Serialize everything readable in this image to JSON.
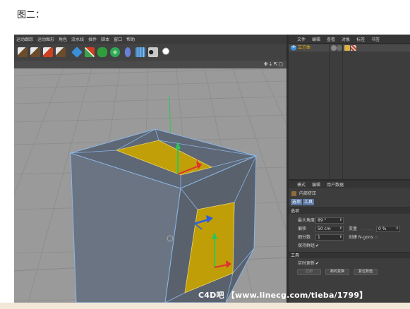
{
  "caption": "图二：",
  "menubar": {
    "items": [
      "运动跟踪",
      "运动图形",
      "角色",
      "流水线",
      "插件",
      "脚本",
      "窗口",
      "帮助"
    ]
  },
  "toolbar": {
    "icons": [
      "render-region-icon",
      "render-view-icon",
      "render-picture-viewer-icon",
      "render-settings-icon",
      "cube-icon",
      "pen-icon",
      "subdivision-icon",
      "cloner-icon",
      "deformer-icon",
      "floor-icon",
      "camera-icon",
      "light-icon"
    ],
    "colors": [
      "#6a4c2a",
      "#6a4c2a",
      "#6a4c2a",
      "#6a4c2a",
      "#3a8fd6",
      "#3aa34a",
      "#2f9e3a",
      "#2fa85a",
      "#6a7fd8",
      "#4d8fc9",
      "#c8c8c8",
      "#e8e8e8"
    ]
  },
  "viewport": {
    "nav_icons": "✥⇣⇱▢"
  },
  "object_manager": {
    "menu": [
      "文件",
      "编辑",
      "查看",
      "对象",
      "标签",
      "书签"
    ],
    "object": {
      "name": "立方体",
      "icon": "cube-icon"
    }
  },
  "attribute_manager": {
    "menu": [
      "模式",
      "编辑",
      "用户数据"
    ],
    "tool_name": "内部挤压",
    "tabs": [
      "选项",
      "工具"
    ],
    "sections": {
      "options": "选项",
      "tool": "工具"
    },
    "fields": {
      "max_angle_label": "最大角度",
      "max_angle_value": "89 °",
      "offset_label": "偏移",
      "offset_value": "50 cm",
      "variance_label": "变量",
      "variance_dots": ". . . . .",
      "variance_value": "0 %",
      "subdivision_label": "细分数",
      "subdivision_value": "1",
      "ngons_label": "创建 N-gons",
      "keep_groups_label": "保持群组",
      "keep_groups_check": "✔",
      "realtime_label": "实时更新",
      "realtime_check": "✔"
    },
    "buttons": {
      "apply": "应用",
      "new_transform": "新的变换",
      "reset": "复位数值"
    }
  },
  "watermark": "C4D吧 【www.linecg.com/tieba/1799】",
  "colors": {
    "selection_yellow": "#c9a400",
    "edge_blue": "#8ab6e6",
    "cube_face": "#6e7784",
    "viewport_bg": "#9a9a9a"
  }
}
